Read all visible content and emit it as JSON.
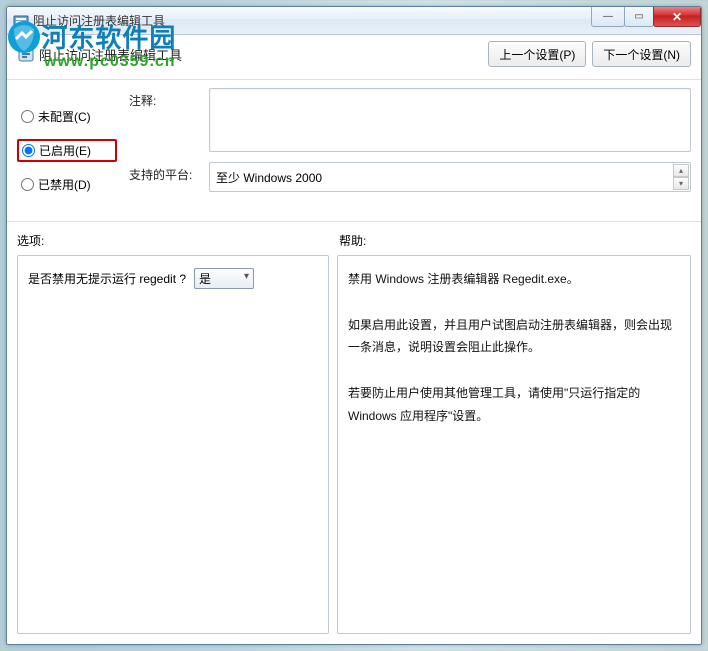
{
  "window": {
    "title": "阻止访问注册表编辑工具"
  },
  "watermark": {
    "line1": "河东软件园",
    "line2": "www.pc0359.cn"
  },
  "header": {
    "policy_name": "阻止访问注册表编辑工具",
    "prev_btn": "上一个设置(P)",
    "next_btn": "下一个设置(N)"
  },
  "radios": {
    "not_configured": "未配置(C)",
    "enabled": "已启用(E)",
    "disabled": "已禁用(D)",
    "selected": "enabled"
  },
  "fields": {
    "comment_label": "注释:",
    "comment_value": "",
    "platform_label": "支持的平台:",
    "platform_value": "至少 Windows 2000"
  },
  "section_labels": {
    "options": "选项:",
    "help": "帮助:"
  },
  "options": {
    "question": "是否禁用无提示运行 regedit ?",
    "dropdown_value": "是"
  },
  "help": {
    "p1": "禁用 Windows 注册表编辑器 Regedit.exe。",
    "p2": "如果启用此设置，并且用户试图启动注册表编辑器，则会出现一条消息，说明设置会阻止此操作。",
    "p3": "若要防止用户使用其他管理工具，请使用\"只运行指定的 Windows 应用程序\"设置。"
  },
  "win_controls": {
    "min": "—",
    "max": "▭",
    "close": "✕"
  }
}
